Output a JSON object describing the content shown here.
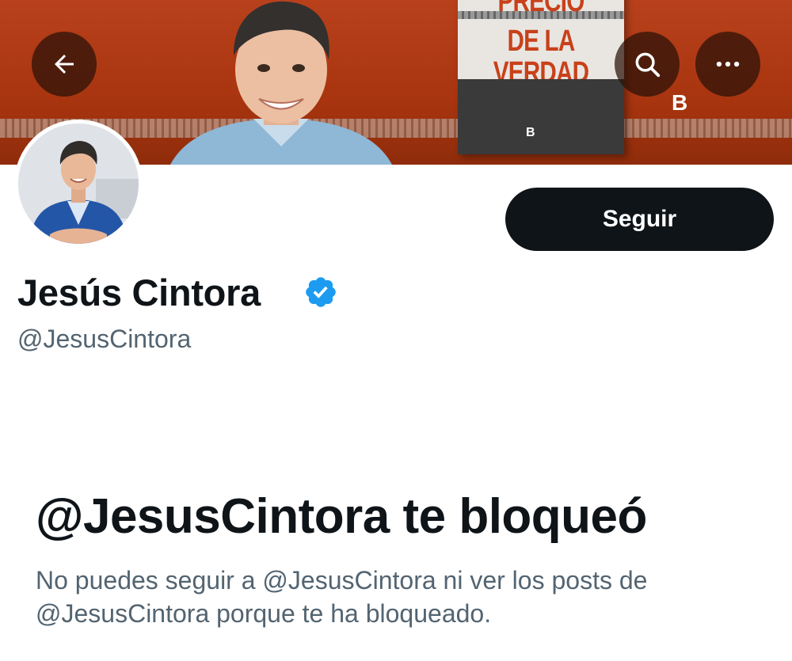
{
  "header": {
    "back_icon": "arrow-left-icon",
    "search_icon": "search-icon",
    "more_icon": "more-horizontal-icon",
    "banner": {
      "book_title_lines": [
        "PRECIO",
        "DE LA",
        "VERDAD"
      ],
      "book_publisher": "B",
      "publisher_logo": "B"
    }
  },
  "profile": {
    "display_name": "Jesús Cintora",
    "handle": "@JesusCintora",
    "verified_icon": "verified-badge-icon",
    "follow_label": "Seguir"
  },
  "blocked": {
    "title": "@JesusCintora te bloqueó",
    "description": "No puedes seguir a @JesusCintora ni ver los posts de @JesusCintora porque te ha bloqueado."
  },
  "colors": {
    "banner": "#a8350f",
    "button_bg": "#0f1419",
    "secondary_text": "#536471",
    "verified": "#1d9bf0"
  }
}
